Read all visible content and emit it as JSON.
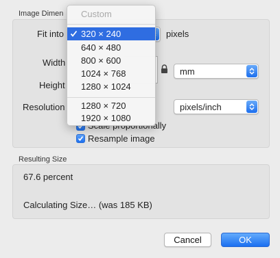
{
  "image_dimensions": {
    "title": "Image Dimen",
    "fit_into_label": "Fit into",
    "fit_unit": "pixels",
    "width_label": "Width",
    "height_label": "Height",
    "unit_value": "mm",
    "resolution_label": "Resolution",
    "resolution_unit": "pixels/inch",
    "scale_label": "Scale proportionally",
    "scale_checked": true,
    "resample_label": "Resample image",
    "resample_checked": true
  },
  "fit_menu": {
    "custom": "Custom",
    "items": [
      "320 × 240",
      "640 × 480",
      "800 × 600",
      "1024 × 768",
      "1280 × 1024"
    ],
    "items2": [
      "1280 × 720",
      "1920 × 1080"
    ],
    "selected": "320 × 240"
  },
  "resulting_size": {
    "title": "Resulting Size",
    "percent": "67.6 percent",
    "status": "Calculating Size… (was 185 KB)"
  },
  "buttons": {
    "cancel": "Cancel",
    "ok": "OK"
  },
  "colors": {
    "accent": "#2f6de1",
    "button_blue": "#1d6fee"
  }
}
